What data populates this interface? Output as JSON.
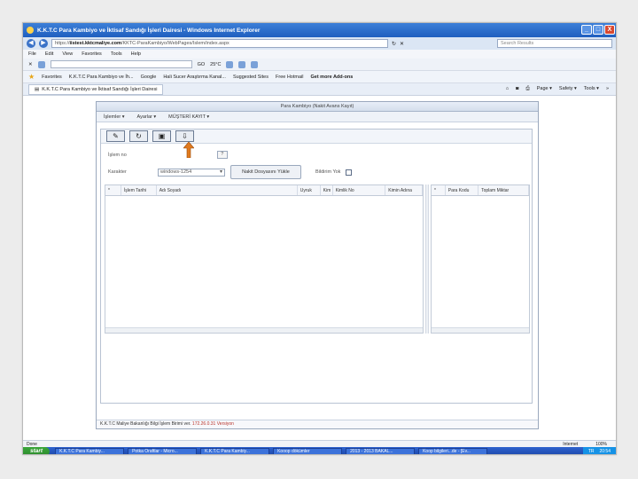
{
  "window": {
    "title": "K.K.T.C Para Kambiyo ve İktisaf Sandığı İşleri Dairesi - Windows Internet Explorer",
    "min": "_",
    "max": "□",
    "close": "X"
  },
  "address": {
    "url_prefix": "https://",
    "url_host": "iistest.kktcmaliye.com",
    "url_path": "/KKTC-ParaKambiyo/WebPages/Islem/index.aspx",
    "search_placeholder": "Search Results"
  },
  "menu": [
    "File",
    "Edit",
    "View",
    "Favorites",
    "Tools",
    "Help"
  ],
  "toolbar": {
    "go_label": "GO",
    "weather": "25°C"
  },
  "favorites": {
    "label": "Favorites",
    "items": [
      "K.K.T.C Para Kambiyo ve İh...",
      "Google",
      "Hali Sucer Araştırma Kanal...",
      "Suggested Sites",
      "Free Hotmail",
      "Get more Add-ons"
    ]
  },
  "tab": {
    "label": "K.K.T.C Para Kambiyo ve İktisaf Sandığı İşleri Dairesi",
    "tools": [
      "Page ▾",
      "Safety ▾",
      "Tools ▾",
      "»"
    ]
  },
  "app": {
    "title": "Para Kambiyo (Nakit Avans Kayıt)",
    "menu": [
      "İşlemler ▾",
      "Ayarlar ▾",
      "MÜŞTERİ KAYIT ▾"
    ],
    "buttons": [
      "✎",
      "↻",
      "▣",
      "⇩"
    ],
    "islem_no_label": "İşlem no",
    "islem_no_btn": "?",
    "karakter_label": "Karakter",
    "karakter_value": "windows-1254",
    "load_btn": "Nakit Dosyasını Yükle",
    "bildirim_label": "Bildirim Yok",
    "left_grid_cols": [
      "*",
      "İşlem Tarihi",
      "Adı Soyadı",
      "Uyruk",
      "Kim",
      "Kimlik No",
      "Kimin Adına"
    ],
    "right_grid_cols": [
      "*",
      "Para Kodu",
      "Toplam Miktar"
    ],
    "footer_prefix": "K.K.T.C Maliye Bakanlığı Bilgi İşlem Birimi ver.",
    "footer_version": " 172.26.0.31 ",
    "footer_suffix": "Versiyon"
  },
  "status": {
    "left": "Done",
    "zone": "Internet",
    "zoom": "100%"
  },
  "taskbar": {
    "start": "start",
    "tasks": [
      "K.K.T.C Para Kambiy...",
      "Potka Oraftlar - Micro...",
      "K.K.T.C Para Kambiy...",
      "Kooop dökümler",
      "2013 - 2013 BAKAL...",
      "Koop bilgileri...de - [Ev..."
    ],
    "tray_lang": "TR",
    "clock": "20:54"
  }
}
